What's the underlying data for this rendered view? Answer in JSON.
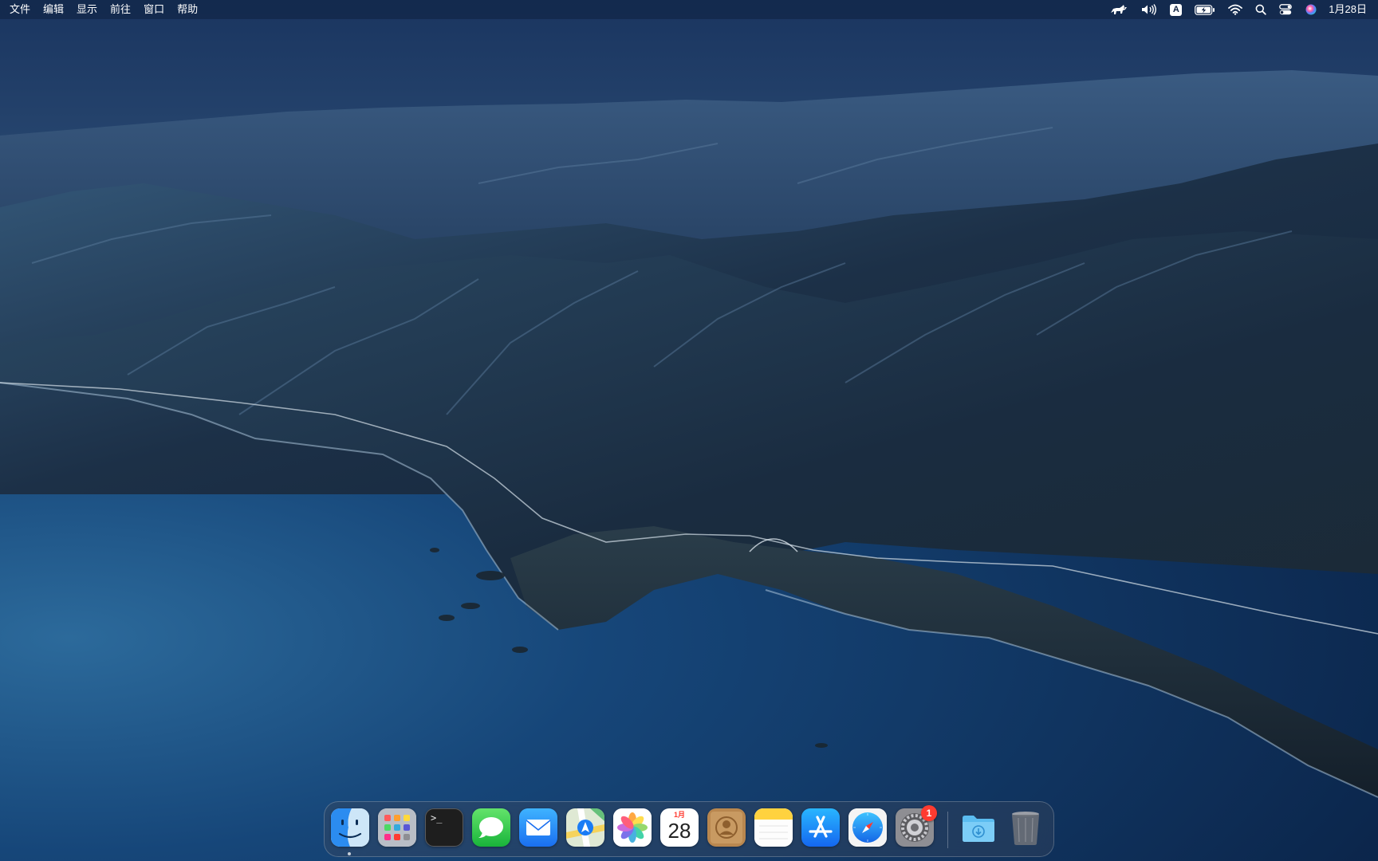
{
  "menubar": {
    "menus": [
      "文件",
      "编辑",
      "显示",
      "前往",
      "窗口",
      "帮助"
    ],
    "status_icons": [
      {
        "name": "cat-app-icon"
      },
      {
        "name": "volume-icon"
      },
      {
        "name": "input-source-icon",
        "text": "A"
      },
      {
        "name": "battery-charging-icon"
      },
      {
        "name": "wifi-icon"
      },
      {
        "name": "spotlight-search-icon"
      },
      {
        "name": "control-center-icon"
      },
      {
        "name": "siri-icon"
      }
    ],
    "clock": "1月28日"
  },
  "dock": {
    "apps": [
      {
        "name": "Finder",
        "icon": "finder-icon",
        "running": true
      },
      {
        "name": "Launchpad",
        "icon": "launchpad-icon"
      },
      {
        "name": "Terminal",
        "icon": "terminal-icon",
        "glyph": ">_"
      },
      {
        "name": "Messages",
        "icon": "messages-icon"
      },
      {
        "name": "Mail",
        "icon": "mail-icon"
      },
      {
        "name": "Maps",
        "icon": "maps-icon"
      },
      {
        "name": "Photos",
        "icon": "photos-icon"
      },
      {
        "name": "Calendar",
        "icon": "calendar-icon",
        "month": "1月",
        "day": "28"
      },
      {
        "name": "Contacts",
        "icon": "contacts-icon"
      },
      {
        "name": "Notes",
        "icon": "notes-icon"
      },
      {
        "name": "App Store",
        "icon": "app-store-icon"
      },
      {
        "name": "Safari",
        "icon": "safari-icon"
      },
      {
        "name": "System Preferences",
        "icon": "system-preferences-icon",
        "badge": "1"
      }
    ],
    "extras": [
      {
        "name": "Downloads",
        "icon": "downloads-folder-icon"
      },
      {
        "name": "Trash",
        "icon": "trash-icon"
      }
    ]
  },
  "colors": {
    "menubar_bg": "#0e2040",
    "badge": "#ff3b30",
    "sea": "#123a6a",
    "mountain": "#1d3350"
  }
}
